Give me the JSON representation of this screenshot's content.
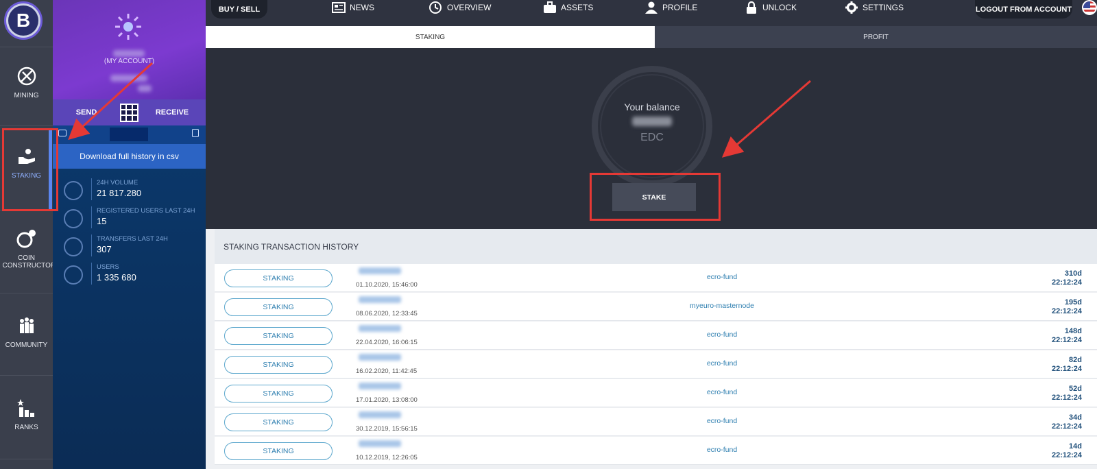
{
  "rail": {
    "logo_letter": "B",
    "items": [
      {
        "label": "MINING",
        "icon": "pickaxe-icon"
      },
      {
        "label": "STAKING",
        "icon": "hand-coin-icon"
      },
      {
        "label": "COIN CONSTRUCTOR",
        "icon": "coin-gear-icon"
      },
      {
        "label": "COMMUNITY",
        "icon": "people-icon"
      },
      {
        "label": "RANKS",
        "icon": "podium-star-icon"
      }
    ],
    "active": "STAKING"
  },
  "account": {
    "label": "(MY ACCOUNT)",
    "send": "SEND",
    "receive": "RECEIVE",
    "download": "Download full history in csv"
  },
  "stats": [
    {
      "label": "24H VOLUME",
      "value": "21 817.280",
      "icon": "volume-icon"
    },
    {
      "label": "REGISTERED USERS LAST 24H",
      "value": "15",
      "icon": "users-clock-icon"
    },
    {
      "label": "TRANSFERS LAST 24H",
      "value": "307",
      "icon": "transfer-icon"
    },
    {
      "label": "USERS",
      "value": "1 335 680",
      "icon": "users-icon"
    }
  ],
  "topnav": {
    "buy_sell": "BUY / SELL",
    "items": [
      {
        "label": "NEWS",
        "icon": "news-icon"
      },
      {
        "label": "OVERVIEW",
        "icon": "clock-icon"
      },
      {
        "label": "ASSETS",
        "icon": "briefcase-icon"
      },
      {
        "label": "PROFILE",
        "icon": "person-icon"
      },
      {
        "label": "UNLOCK",
        "icon": "lock-icon"
      },
      {
        "label": "SETTINGS",
        "icon": "gear-icon"
      }
    ],
    "logout": "LOGOUT FROM ACCOUNT",
    "language_flag": "us-flag-icon"
  },
  "tabs": {
    "staking": "STAKING",
    "profit": "PROFIT",
    "active": "STAKING"
  },
  "balance": {
    "label": "Your balance",
    "currency": "EDC",
    "stake_button": "STAKE"
  },
  "history": {
    "title": "STAKING TRANSACTION HISTORY",
    "rows": [
      {
        "type": "STAKING",
        "date": "01.10.2020, 15:46:00",
        "node": "ecro-fund",
        "days": "310d",
        "time": "22:12:24"
      },
      {
        "type": "STAKING",
        "date": "08.06.2020, 12:33:45",
        "node": "myeuro-masternode",
        "days": "195d",
        "time": "22:12:24"
      },
      {
        "type": "STAKING",
        "date": "22.04.2020, 16:06:15",
        "node": "ecro-fund",
        "days": "148d",
        "time": "22:12:24"
      },
      {
        "type": "STAKING",
        "date": "16.02.2020, 11:42:45",
        "node": "ecro-fund",
        "days": "82d",
        "time": "22:12:24"
      },
      {
        "type": "STAKING",
        "date": "17.01.2020, 13:08:00",
        "node": "ecro-fund",
        "days": "52d",
        "time": "22:12:24"
      },
      {
        "type": "STAKING",
        "date": "30.12.2019, 15:56:15",
        "node": "ecro-fund",
        "days": "34d",
        "time": "22:12:24"
      },
      {
        "type": "STAKING",
        "date": "10.12.2019, 12:26:05",
        "node": "ecro-fund",
        "days": "14d",
        "time": "22:12:24"
      }
    ]
  },
  "colors": {
    "accent": "#5b86f0",
    "highlight": "#e53935",
    "link": "#2f7fb0"
  }
}
